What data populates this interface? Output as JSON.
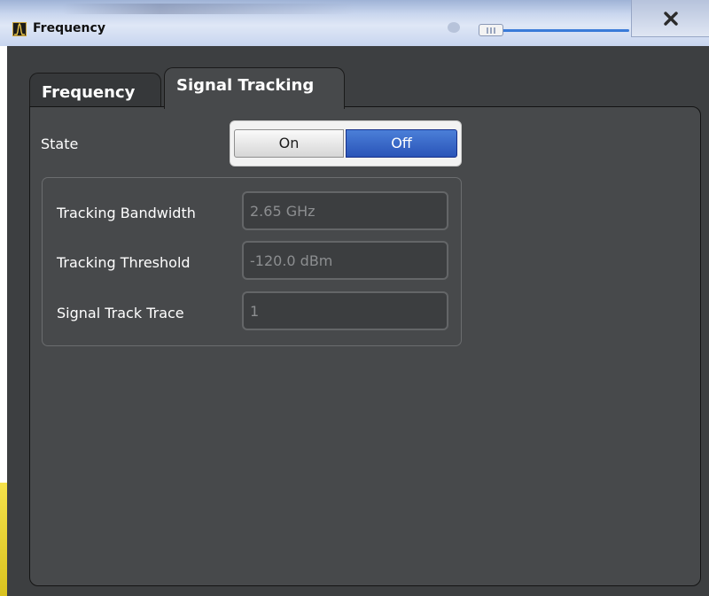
{
  "window": {
    "title": "Frequency",
    "close_icon": "close-x-icon",
    "app_icon": "spectrum-icon"
  },
  "tabs": [
    {
      "label": "Frequency",
      "active": false
    },
    {
      "label": "Signal Tracking",
      "active": true
    }
  ],
  "state": {
    "label": "State",
    "options": [
      "On",
      "Off"
    ],
    "selected": "Off"
  },
  "fields": [
    {
      "label": "Tracking Bandwidth",
      "value": "2.65 GHz"
    },
    {
      "label": "Tracking Threshold",
      "value": "-120.0 dBm"
    },
    {
      "label": "Signal Track Trace",
      "value": "1"
    }
  ],
  "colors": {
    "panel": "#47494b",
    "selected_toggle": "#2a54b8",
    "accent_strip": "#f5e14a"
  }
}
